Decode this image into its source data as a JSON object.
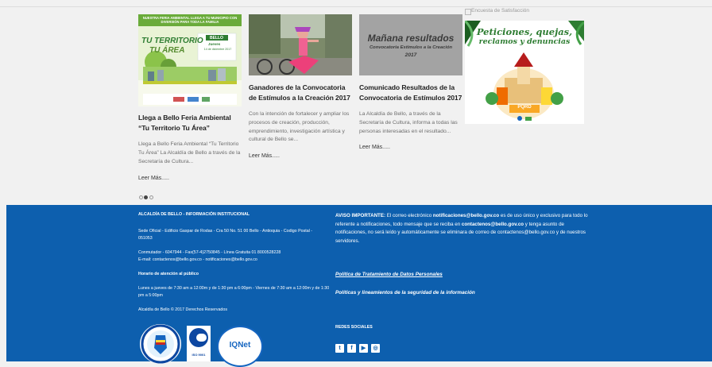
{
  "cards": [
    {
      "title": "Llega a Bello Feria Ambiental “Tu Territorio Tu Área”",
      "text": "Llega a Bello Feria Ambiental “Tu Territorio Tu Área” La Alcaldía de Bello a través de la Secretaría de Cultura...",
      "more": "Leer Más.....",
      "image": {
        "banner": "NUESTRA FERIA AMBIENTAL LLEGA A TU MUNICIPIO CON DIVERSIÓN PARA TODA LA FAMILIA",
        "headline_1": "TU TERRITORIO",
        "headline_2": "TU ÁREA",
        "place": "BELLO",
        "day": "Jueves",
        "date": "14 de diciembre 2017"
      }
    },
    {
      "title": "Ganadores de la Convocatoria de Estímulos a la Creación 2017",
      "text": "Con la intención de fortalecer y ampliar los procesos de creación, producción, emprendimiento, investigación artística y cultural de Bello se...",
      "more": "Leer Más.....",
      "image": {}
    },
    {
      "title": "Comunicado Resultados de la Convocatoria de Estímulos 2017",
      "text": "La Alcaldía de Bello, a través de la Secretaría de Cultura, informa a todas las personas interesadas en el resultado...",
      "more": "Leer Más.....",
      "image": {
        "line1": "Mañana resultados",
        "line2": "Convocatoria Estímulos a la Creación",
        "line3": "2017"
      }
    }
  ],
  "survey": {
    "alt": "Encuesta de Satisfacción",
    "line1": "Peticiones, quejas,",
    "line2": "reclamos y denuncias",
    "badge": "PQRD"
  },
  "footer": {
    "heading": "ALCALDÍA DE BELLO - INFORMACIÓN INSTITUCIONAL",
    "address": "Sede Oficial - Edificio Gaspar de Rodas - Cra 50 No. 51 00 Bello - Antioquia - Codigo Postal - 051053",
    "phone": "Conmutador - 6047944 - Fax(57-4)2750845 - Línea Gratuita 01 8000528228",
    "email": "E-mail: contactenos@bello.gov.co - notificaciones@bello.gov.co",
    "hours_title": "Horario de atención al público",
    "hours": "Lunes a jueves de 7:30 am a 12:00m y de 1:30 pm a 6:00pm - Viernes de 7:30 am a 12:00m y de 1:30 pm a 5:00pm",
    "copyright": "Alcaldía de Bello © 2017 Derechos Reservados",
    "notice_label": "AVISO IMPORTANTE:",
    "notice_1": " El correo electrónico ",
    "notice_email1": "notificaciones@bello.gov.co",
    "notice_2": " es de uso único y exclusivo para todo lo referente a notificaciones, todo mensaje que se reciba en ",
    "notice_email2": "contactenos@bello.gov.co",
    "notice_3": " y tenga asunto de notificaciones, no será leído y automáticamente se eliminara de correo de contactenos@bello.gov.co y de nuestros servidores.",
    "link_privacy": "Política de Tratamiento de Datos Personales",
    "link_security": "Políticas y lineamientos de la seguridad de la información",
    "social_title": "REDES SOCIALES",
    "social_icons": [
      "twitter-icon",
      "facebook-icon",
      "youtube-icon",
      "instagram-icon"
    ],
    "cert_iso": "ISO 9001",
    "cert_iqnet": "IQNet"
  },
  "colors": {
    "footer_bg": "#0d5fae",
    "page_bg": "#f1f1f1"
  }
}
